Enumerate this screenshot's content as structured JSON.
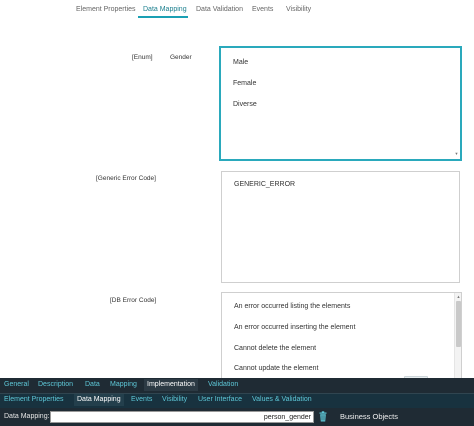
{
  "top_tabs": [
    {
      "label": "Element Properties",
      "active": false
    },
    {
      "label": "Data Mapping",
      "active": true
    },
    {
      "label": "Data Validation",
      "active": false
    },
    {
      "label": "Events",
      "active": false
    },
    {
      "label": "Visibility",
      "active": false
    }
  ],
  "rows": {
    "enum": {
      "type_label": "[Enum]",
      "name_label": "Gender",
      "items": [
        "Male",
        "Female",
        "Diverse"
      ]
    },
    "generic_error": {
      "type_label": "[Generic Error Code]",
      "items": [
        "GENERIC_ERROR"
      ]
    },
    "db_error": {
      "type_label": "[DB Error Code]",
      "items": [
        "An error occurred listing the elements",
        "An error occurred inserting the element",
        "Cannot delete the element",
        "Cannot update the element"
      ]
    }
  },
  "bottom": {
    "row1_tabs": [
      {
        "label": "General",
        "active": false
      },
      {
        "label": "Description",
        "active": false
      },
      {
        "label": "Data",
        "active": false
      },
      {
        "label": "Mapping",
        "active": false
      },
      {
        "label": "Implementation",
        "active": true
      },
      {
        "label": "Validation",
        "active": false
      }
    ],
    "row2_tabs": [
      {
        "label": "Element Properties",
        "active": false
      },
      {
        "label": "Data Mapping",
        "active": true
      },
      {
        "label": "Events",
        "active": false
      },
      {
        "label": "Visibility",
        "active": false
      },
      {
        "label": "User Interface",
        "active": false
      },
      {
        "label": "Values & Validation",
        "active": false
      }
    ],
    "data_mapping_label": "Data Mapping:",
    "data_mapping_value": "person_gender",
    "business_objects_label": "Business Objects"
  },
  "icons": {
    "trash": "trash-icon",
    "scroll_up": "chevron-up-icon",
    "scroll_down": "chevron-down-icon"
  },
  "colors": {
    "accent": "#2aa9bc",
    "active_tab_text": "#1a7f8e",
    "panel_bg": "#1f2b34",
    "panel_tab_text": "#5ec8d8"
  }
}
